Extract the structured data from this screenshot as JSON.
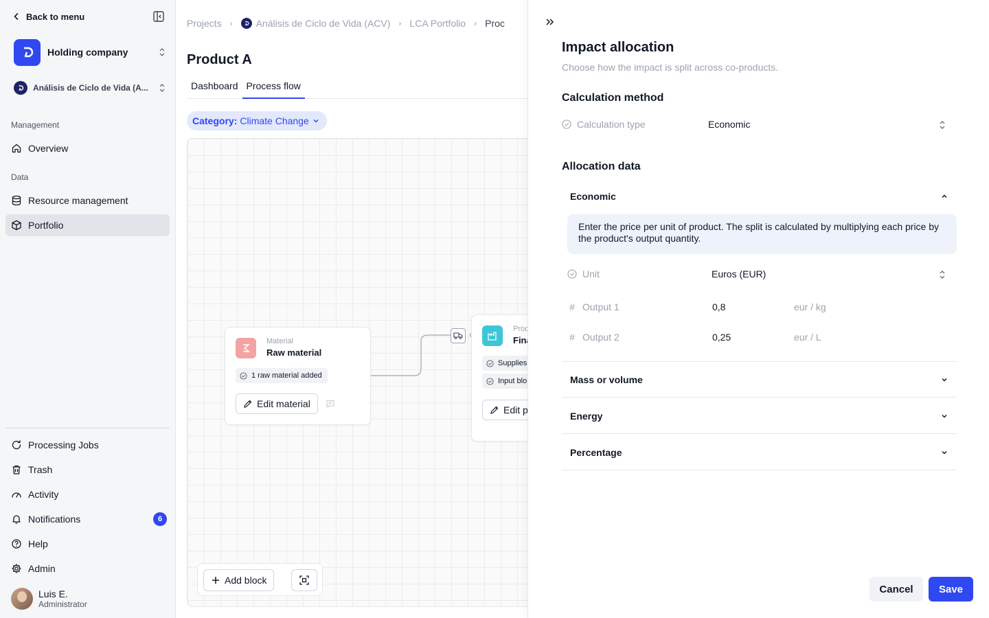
{
  "sidebar": {
    "back_label": "Back to menu",
    "company": "Holding company",
    "project": "Análisis de Ciclo de Vida (A...",
    "management_label": "Management",
    "data_label": "Data",
    "items": {
      "overview": "Overview",
      "resource_management": "Resource management",
      "portfolio": "Portfolio",
      "processing_jobs": "Processing Jobs",
      "trash": "Trash",
      "activity": "Activity",
      "notifications": "Notifications",
      "help": "Help",
      "admin": "Admin"
    },
    "notifications_count": "6",
    "user": {
      "name": "Luis E.",
      "role": "Administrator"
    }
  },
  "breadcrumb": [
    "Projects",
    "Análisis de Ciclo de Vida (ACV)",
    "LCA Portfolio",
    "Proc"
  ],
  "page": {
    "title": "Product A",
    "tabs": [
      "Dashboard",
      "Process flow"
    ],
    "active_tab": "Process flow",
    "category_label": "Category:",
    "category_value": "Climate Change"
  },
  "flow": {
    "material_block": {
      "type": "Material",
      "title": "Raw material",
      "chip": "1 raw material added",
      "edit_label": "Edit material"
    },
    "process_block": {
      "type": "Proc",
      "title": "Fina",
      "chip1": "Supplies",
      "chip2": "Input blo",
      "edit_label": "Edit p"
    },
    "add_block_label": "Add block"
  },
  "drawer": {
    "title": "Impact allocation",
    "subtitle": "Choose how the impact is split across co-products.",
    "calc_heading": "Calculation method",
    "calc_type_label": "Calculation type",
    "calc_type_value": "Economic",
    "alloc_heading": "Allocation data",
    "economic": {
      "title": "Economic",
      "info": "Enter the price per unit of product. The split is calculated by multiplying each price by the product's output quantity.",
      "unit_label": "Unit",
      "unit_value": "Euros (EUR)",
      "outputs": [
        {
          "label": "Output 1",
          "value": "0,8",
          "unit": "eur / kg"
        },
        {
          "label": "Output 2",
          "value": "0,25",
          "unit": "eur / L"
        }
      ]
    },
    "sections": [
      "Mass or volume",
      "Energy",
      "Percentage"
    ],
    "cancel_label": "Cancel",
    "save_label": "Save"
  },
  "colors": {
    "accent": "#2f48f2",
    "material_icon_bg": "#f2a3a3",
    "process_icon_bg": "#3cc6d6"
  }
}
